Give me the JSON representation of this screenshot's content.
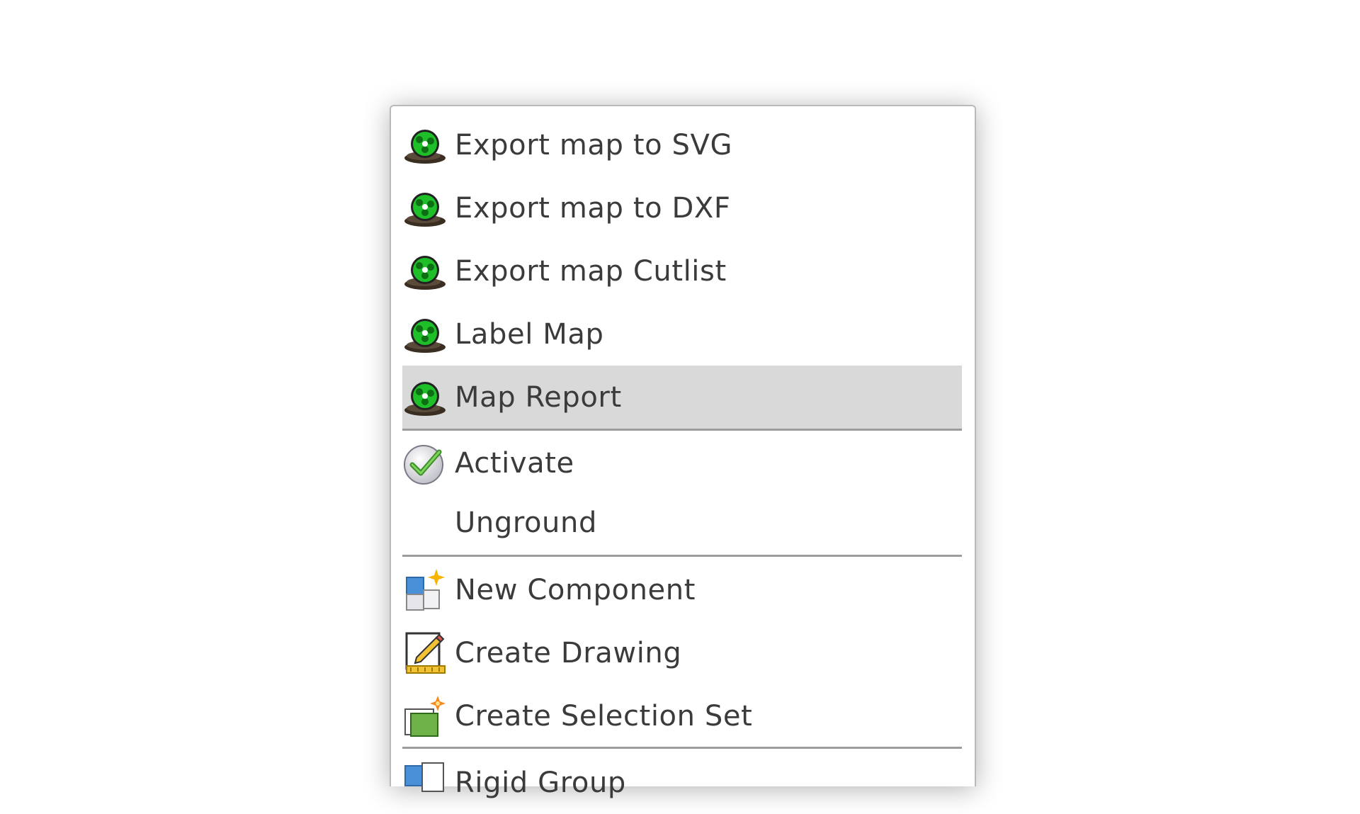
{
  "menu": {
    "items": [
      {
        "label": "Export map to SVG",
        "icon": "map-green-icon"
      },
      {
        "label": "Export map to DXF",
        "icon": "map-green-icon"
      },
      {
        "label": "Export map Cutlist",
        "icon": "map-green-icon"
      },
      {
        "label": "Label Map",
        "icon": "map-green-icon"
      },
      {
        "label": "Map Report",
        "icon": "map-green-icon",
        "highlighted": true
      },
      {
        "label": "Activate",
        "icon": "checkmark-circle-icon"
      },
      {
        "label": "Unground",
        "icon": ""
      },
      {
        "label": "New Component",
        "icon": "new-component-icon"
      },
      {
        "label": "Create Drawing",
        "icon": "create-drawing-icon"
      },
      {
        "label": "Create Selection Set",
        "icon": "selection-set-icon"
      },
      {
        "label": "Rigid Group",
        "icon": "rigid-group-icon"
      }
    ]
  },
  "colors": {
    "highlight": "#d9d9d9",
    "separator": "#9c9c9c",
    "text": "#3b3b3b",
    "map_green": "#1fbf2a"
  }
}
